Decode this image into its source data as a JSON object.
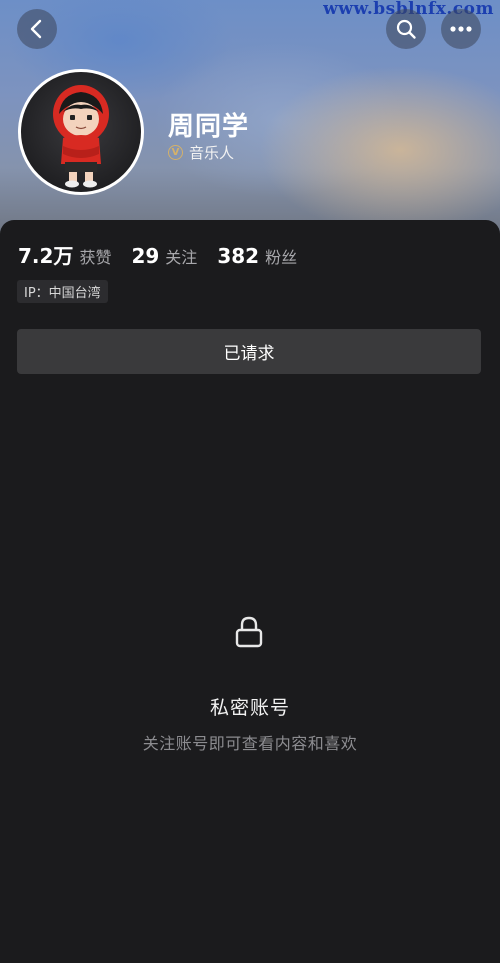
{
  "watermark": "www.bsblnfx.com",
  "profile": {
    "name": "周同学",
    "verification": "音乐人",
    "verification_badge": "V"
  },
  "stats": [
    {
      "value": "7.2万",
      "label": "获赞"
    },
    {
      "value": "29",
      "label": "关注"
    },
    {
      "value": "382",
      "label": "粉丝"
    }
  ],
  "ip_location": "IP：中国台湾",
  "request_button": "已请求",
  "private": {
    "title": "私密账号",
    "subtitle": "关注账号即可查看内容和喜欢"
  },
  "icons": {
    "back": "chevron-left-icon",
    "search": "search-icon",
    "more": "more-dots-icon",
    "lock": "lock-icon"
  },
  "colors": {
    "background": "#1b1b1d",
    "button": "#3a3a3c",
    "verify_gold": "#d4b16a"
  }
}
